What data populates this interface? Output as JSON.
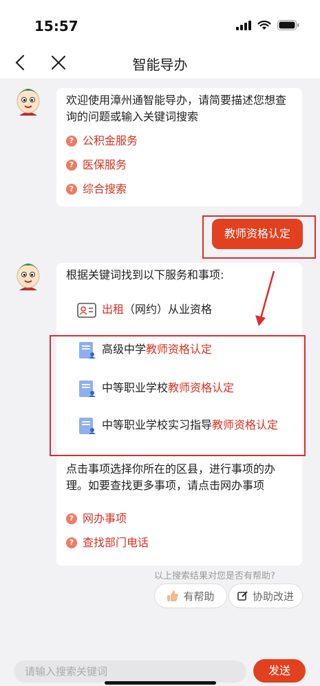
{
  "status": {
    "time": "15:57"
  },
  "nav": {
    "title": "智能导办"
  },
  "greeting": {
    "text": "欢迎使用漳州通智能导办，请简要描述您想查询的问题或输入关键词搜索",
    "links": [
      "公积金服务",
      "医保服务",
      "综合搜索"
    ]
  },
  "user_message": "教师资格认定",
  "result": {
    "intro": "根据关键词找到以下服务和事项:",
    "service": {
      "highlight": "出租",
      "rest": "（网约）从业资格"
    },
    "items": [
      {
        "prefix": "高级中学",
        "highlight": "教师资格认定"
      },
      {
        "prefix": "中等职业学校",
        "highlight": "教师资格认定"
      },
      {
        "prefix": "中等职业学校实习指导",
        "highlight": "教师资格认定"
      }
    ],
    "tail": "点击事项选择你所在的区县，进行事项的办理。如要查找更多事项，请点击网办事项",
    "links": [
      "网办事项",
      "查找部门电话"
    ]
  },
  "feedback": {
    "question": "以上搜索结果对您是否有帮助?",
    "helpful": "有帮助",
    "improve": "协助改进"
  },
  "input": {
    "placeholder": "请输入搜索关键词"
  },
  "send_label": "发送",
  "colors": {
    "accent": "#e2401e",
    "highlight": "#d8311f",
    "frame": "#e02b2b"
  }
}
